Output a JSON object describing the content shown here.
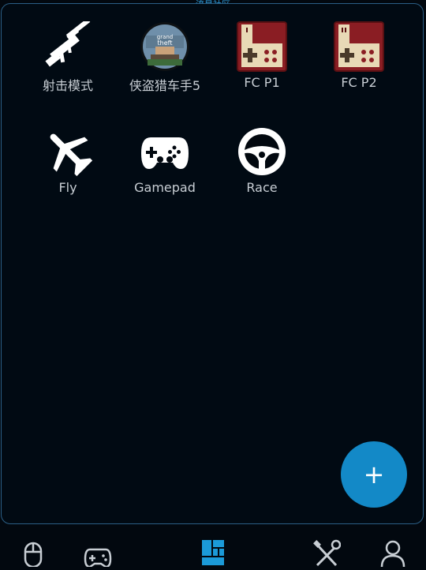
{
  "header": {
    "title": "流星社区"
  },
  "tiles": [
    {
      "label": "射击模式",
      "icon": "sniper-rifle-icon"
    },
    {
      "label": "侠盗猎车手5",
      "icon": "gta5-logo-icon"
    },
    {
      "label": "FC P1",
      "icon": "famicom-controller-icon"
    },
    {
      "label": "FC P2",
      "icon": "famicom-controller-icon"
    },
    {
      "label": "Fly",
      "icon": "airplane-icon"
    },
    {
      "label": "Gamepad",
      "icon": "gamepad-icon"
    },
    {
      "label": "Race",
      "icon": "steering-wheel-icon"
    }
  ],
  "fab": {
    "label": "+",
    "icon": "plus-icon"
  },
  "bottom_nav": [
    {
      "icon": "mouse-icon"
    },
    {
      "icon": "gamepad-icon"
    },
    {
      "icon": "layout-grid-icon",
      "active": true
    },
    {
      "icon": "tools-icon"
    },
    {
      "icon": "user-icon"
    }
  ],
  "colors": {
    "background": "#02080f",
    "accent": "#1389c7",
    "border": "#2b5f86",
    "text": "#c8ced4"
  }
}
